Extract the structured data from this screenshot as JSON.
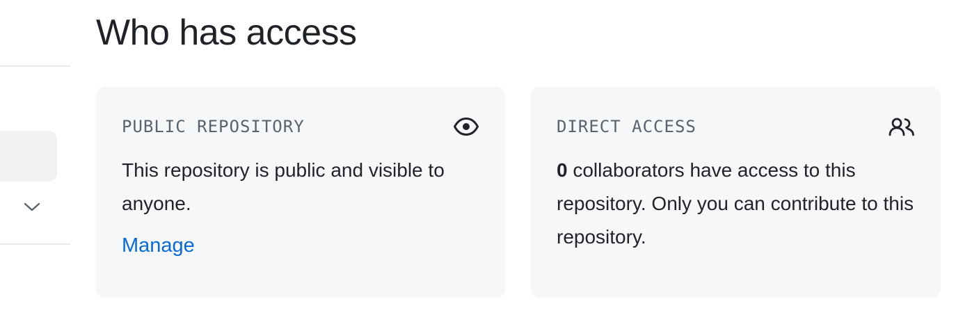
{
  "page_title": "Who has access",
  "sidebar": {
    "expand_icon": "chevron-down-icon"
  },
  "cards": {
    "public": {
      "label": "PUBLIC REPOSITORY",
      "icon": "eye-icon",
      "body": "This repository is public and visible to anyone.",
      "link_label": "Manage"
    },
    "direct": {
      "label": "DIRECT ACCESS",
      "icon": "people-icon",
      "count": "0",
      "body": " collaborators have access to this repository. Only you can contribute to this repository."
    }
  },
  "colors": {
    "text": "#1f2328",
    "muted": "#59636e",
    "link": "#0969da",
    "card_bg": "#f6f7f9"
  }
}
